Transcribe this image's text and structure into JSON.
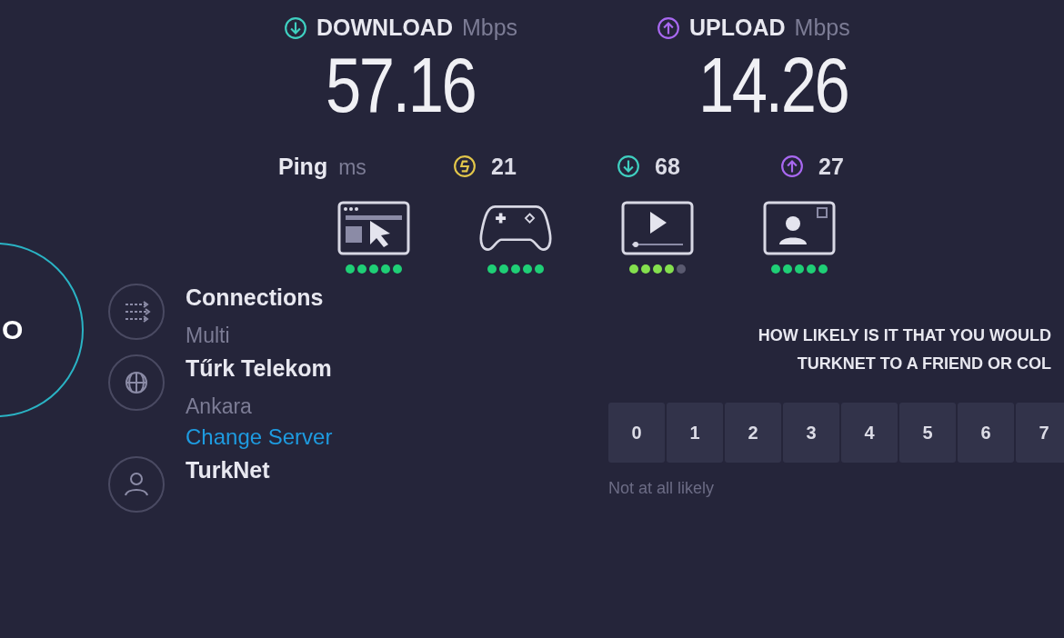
{
  "results": [
    {
      "kind": "download",
      "label": "DOWNLOAD",
      "unit": "Mbps",
      "value": "57.16"
    },
    {
      "kind": "upload",
      "label": "UPLOAD",
      "unit": "Mbps",
      "value": "14.26"
    }
  ],
  "ping": {
    "label": "Ping",
    "unit": "ms",
    "items": [
      {
        "kind": "jitter",
        "value": "21"
      },
      {
        "kind": "download",
        "value": "68"
      },
      {
        "kind": "upload",
        "value": "27"
      }
    ]
  },
  "activities": [
    {
      "kind": "browsing",
      "stars": 5
    },
    {
      "kind": "gaming",
      "stars": 5
    },
    {
      "kind": "streaming",
      "stars": 4
    },
    {
      "kind": "video-chat",
      "stars": 5
    }
  ],
  "go_button": {
    "label": "O"
  },
  "details": [
    {
      "kind": "connections",
      "title": "Connections",
      "subtitle": "Multi"
    },
    {
      "kind": "server",
      "title": "Tűrk Telekom",
      "subtitle": "Ankara",
      "link": "Change Server"
    },
    {
      "kind": "provider",
      "title": "TurkNet"
    }
  ],
  "survey": {
    "question_lines": [
      "HOW LIKELY IS IT THAT YOU WOULD",
      "TURKNET TO A FRIEND OR COL"
    ],
    "scale": [
      "0",
      "1",
      "2",
      "3",
      "4",
      "5",
      "6",
      "7"
    ],
    "low_label": "Not at all likely"
  }
}
